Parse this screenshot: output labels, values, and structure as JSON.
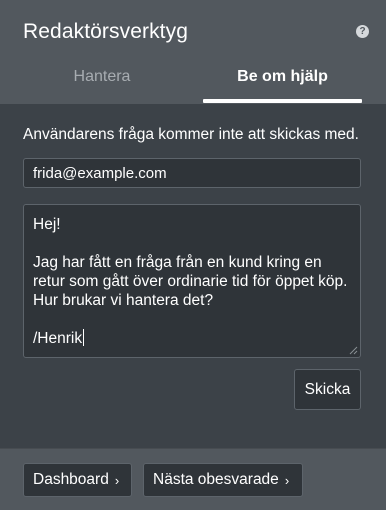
{
  "header": {
    "title": "Redaktörsverktyg",
    "help_icon": "question-circle-icon",
    "tabs": [
      {
        "label": "Hantera",
        "active": false
      },
      {
        "label": "Be om hjälp",
        "active": true
      }
    ]
  },
  "form": {
    "notice": "Användarens fråga kommer inte att skickas med.",
    "email_value": "frida@example.com",
    "message_lines": [
      "Hej!",
      "",
      "Jag har fått en fråga från en kund kring en",
      "retur som gått över ordinarie tid för öppet köp.",
      "Hur brukar vi hantera det?",
      "",
      "/Henrik"
    ],
    "send_label": "Skicka"
  },
  "footer": {
    "dashboard_label": "Dashboard",
    "next_label": "Nästa obesvarade",
    "chevron": "›"
  },
  "colors": {
    "header_bg": "#52585e",
    "body_bg": "#3c4248",
    "field_bg": "#2f3439",
    "inactive_tab": "#a7acb1"
  }
}
